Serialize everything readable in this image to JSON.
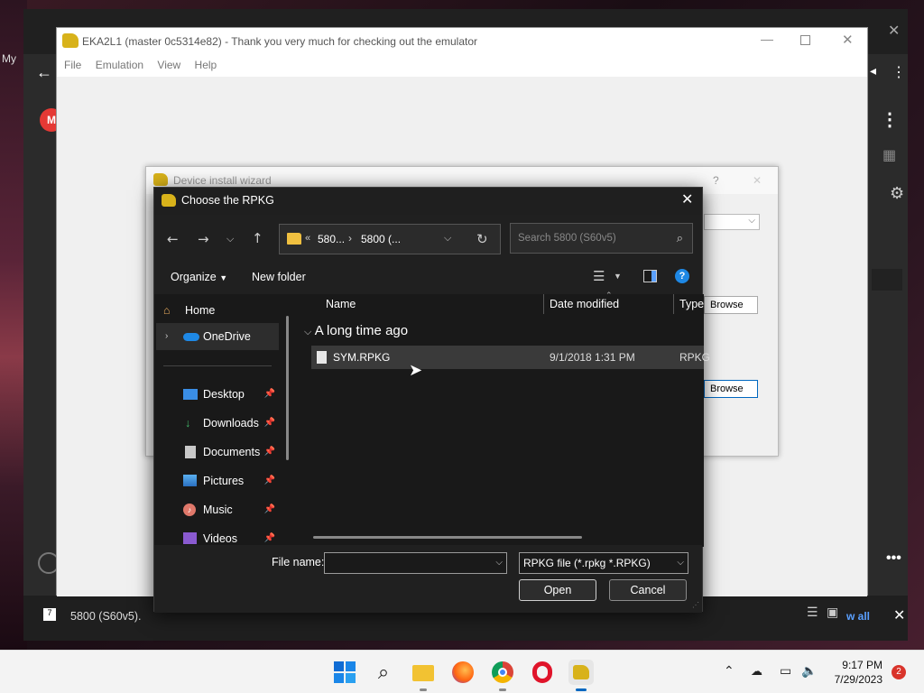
{
  "background_app": {
    "partial_text_left": "My",
    "bottom_left_label": "5800 (S60v5).",
    "bottom_right_link": "w all"
  },
  "emulator": {
    "title": "EKA2L1 (master 0c5314e82) - Thank you very much for checking out the emulator",
    "menu": [
      "File",
      "Emulation",
      "View",
      "Help"
    ]
  },
  "wizard": {
    "title": "Device install wizard",
    "browse_label_1": "Browse",
    "browse_label_2": "Browse",
    "help_glyph": "?"
  },
  "dialog": {
    "title": "Choose the RPKG",
    "address": {
      "segment_1": "580...",
      "segment_2": "5800 (..."
    },
    "search_placeholder": "Search 5800 (S60v5)",
    "toolbar": {
      "organize": "Organize",
      "new_folder": "New folder"
    },
    "nav_pane": [
      {
        "label": "Home",
        "icon": "home-icon",
        "pinned": false
      },
      {
        "label": "OneDrive",
        "icon": "cloud-icon",
        "pinned": false
      },
      {
        "label": "Desktop",
        "icon": "desktop-icon",
        "pinned": true
      },
      {
        "label": "Downloads",
        "icon": "download-icon",
        "pinned": true
      },
      {
        "label": "Documents",
        "icon": "document-icon",
        "pinned": true
      },
      {
        "label": "Pictures",
        "icon": "picture-icon",
        "pinned": true
      },
      {
        "label": "Music",
        "icon": "music-icon",
        "pinned": true
      },
      {
        "label": "Videos",
        "icon": "video-icon",
        "pinned": true
      }
    ],
    "columns": {
      "name": "Name",
      "date_modified": "Date modified",
      "type": "Type"
    },
    "group_label": "A long time ago",
    "files": [
      {
        "name": "SYM.RPKG",
        "date": "9/1/2018 1:31 PM",
        "type": "RPKG"
      }
    ],
    "file_name_label": "File name:",
    "file_name_value": "",
    "filter": "RPKG file (*.rpkg *.RPKG)",
    "open_label": "Open",
    "cancel_label": "Cancel"
  },
  "taskbar": {
    "time": "9:17 PM",
    "date": "7/29/2023",
    "notification_count": "2"
  },
  "colors": {
    "dialog_bg": "#191919",
    "selection": "#3a3a3a",
    "taskbar_bg": "#f3f3f3",
    "accent_blue": "#0067c0"
  }
}
